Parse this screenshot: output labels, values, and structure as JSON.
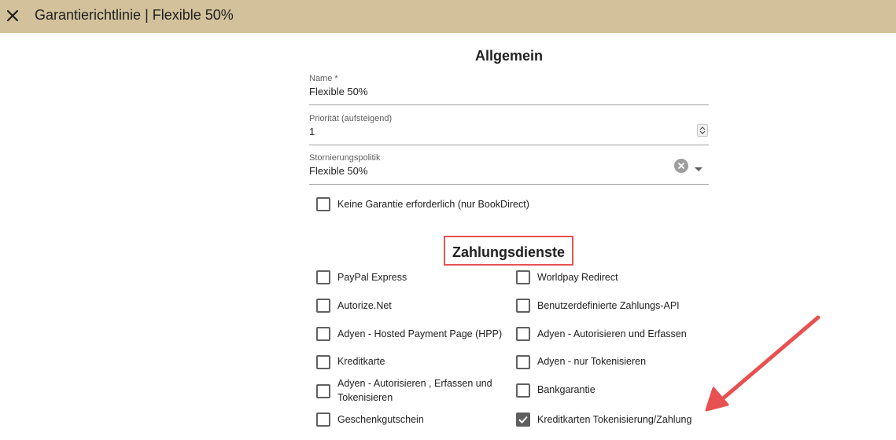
{
  "header": {
    "title": "Garantierichtlinie | Flexible 50%",
    "close_icon": "close-icon"
  },
  "general": {
    "heading": "Allgemein",
    "name": {
      "label": "Name *",
      "value": "Flexible 50%"
    },
    "priority": {
      "label": "Priorität (aufsteigend)",
      "value": "1"
    },
    "cancellation_policy": {
      "label": "Stornierungspolitik",
      "value": "Flexible 50%"
    },
    "no_guarantee": {
      "label": "Keine Garantie erforderlich (nur BookDirect)",
      "checked": false
    }
  },
  "payment_services": {
    "heading": "Zahlungsdienste",
    "highlight_color": "#e85151",
    "left": [
      {
        "label": "PayPal Express",
        "checked": false
      },
      {
        "label": "Autorize.Net",
        "checked": false
      },
      {
        "label": "Adyen - Hosted Payment Page (HPP)",
        "checked": false
      },
      {
        "label": "Kreditkarte",
        "checked": false
      },
      {
        "label": "Adyen - Autorisieren , Erfassen und Tokenisieren",
        "checked": false
      },
      {
        "label": "Geschenkgutschein",
        "checked": false
      }
    ],
    "right": [
      {
        "label": "Worldpay Redirect",
        "checked": false
      },
      {
        "label": "Benutzerdefinierte Zahlungs-API",
        "checked": false
      },
      {
        "label": "Adyen - Autorisieren und Erfassen",
        "checked": false
      },
      {
        "label": "Adyen - nur Tokenisieren",
        "checked": false
      },
      {
        "label": "Bankgarantie",
        "checked": false
      },
      {
        "label": "Kreditkarten Tokenisierung/Zahlung",
        "checked": true
      }
    ]
  },
  "colors": {
    "header_bg": "#d2c19b",
    "annotation": "#e85151",
    "checkbox_checked": "#5e5e5e"
  }
}
